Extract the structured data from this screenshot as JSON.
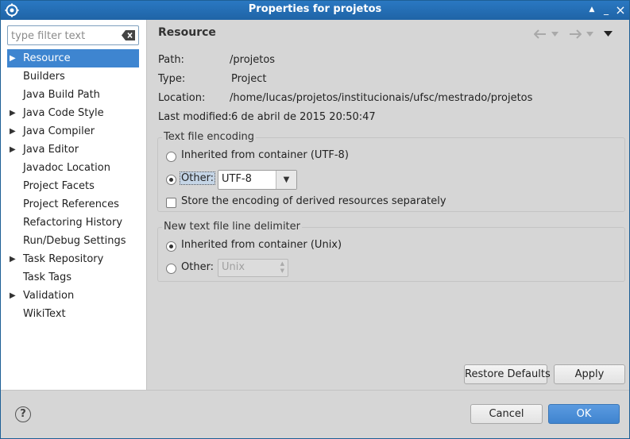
{
  "window": {
    "title": "Properties for projetos",
    "controls": {
      "up": "▲",
      "minimize": "_",
      "close": "×"
    }
  },
  "filter": {
    "placeholder": "type filter text",
    "value": ""
  },
  "tree": {
    "items": [
      {
        "label": "Resource",
        "expandable": true,
        "selected": true
      },
      {
        "label": "Builders",
        "expandable": false
      },
      {
        "label": "Java Build Path",
        "expandable": false
      },
      {
        "label": "Java Code Style",
        "expandable": true
      },
      {
        "label": "Java Compiler",
        "expandable": true
      },
      {
        "label": "Java Editor",
        "expandable": true
      },
      {
        "label": "Javadoc Location",
        "expandable": false
      },
      {
        "label": "Project Facets",
        "expandable": false
      },
      {
        "label": "Project References",
        "expandable": false
      },
      {
        "label": "Refactoring History",
        "expandable": false
      },
      {
        "label": "Run/Debug Settings",
        "expandable": false
      },
      {
        "label": "Task Repository",
        "expandable": true
      },
      {
        "label": "Task Tags",
        "expandable": false
      },
      {
        "label": "Validation",
        "expandable": true
      },
      {
        "label": "WikiText",
        "expandable": false
      }
    ],
    "expander_glyph": "▶"
  },
  "page": {
    "title": "Resource",
    "info": {
      "path_label": "Path:",
      "path_value": "/projetos",
      "type_label": "Type:",
      "type_value": "Project",
      "location_label": "Location:",
      "location_value": "/home/lucas/projetos/institucionais/ufsc/mestrado/projetos",
      "modified_label": "Last modified:",
      "modified_value": "6 de abril de 2015 20:50:47"
    },
    "encoding": {
      "group_title": "Text file encoding",
      "inherited_label": "Inherited from container (UTF-8)",
      "other_label": "Other:",
      "other_value": "UTF-8",
      "selected": "other",
      "derived_label": "Store the encoding of derived resources separately",
      "derived_checked": false
    },
    "delimiter": {
      "group_title": "New text file line delimiter",
      "inherited_label": "Inherited from container (Unix)",
      "other_label": "Other:",
      "other_value": "Unix",
      "selected": "inherited"
    },
    "restore_defaults_label": "Restore Defaults",
    "apply_label": "Apply"
  },
  "footer": {
    "help_glyph": "?",
    "cancel_label": "Cancel",
    "ok_label": "OK"
  }
}
